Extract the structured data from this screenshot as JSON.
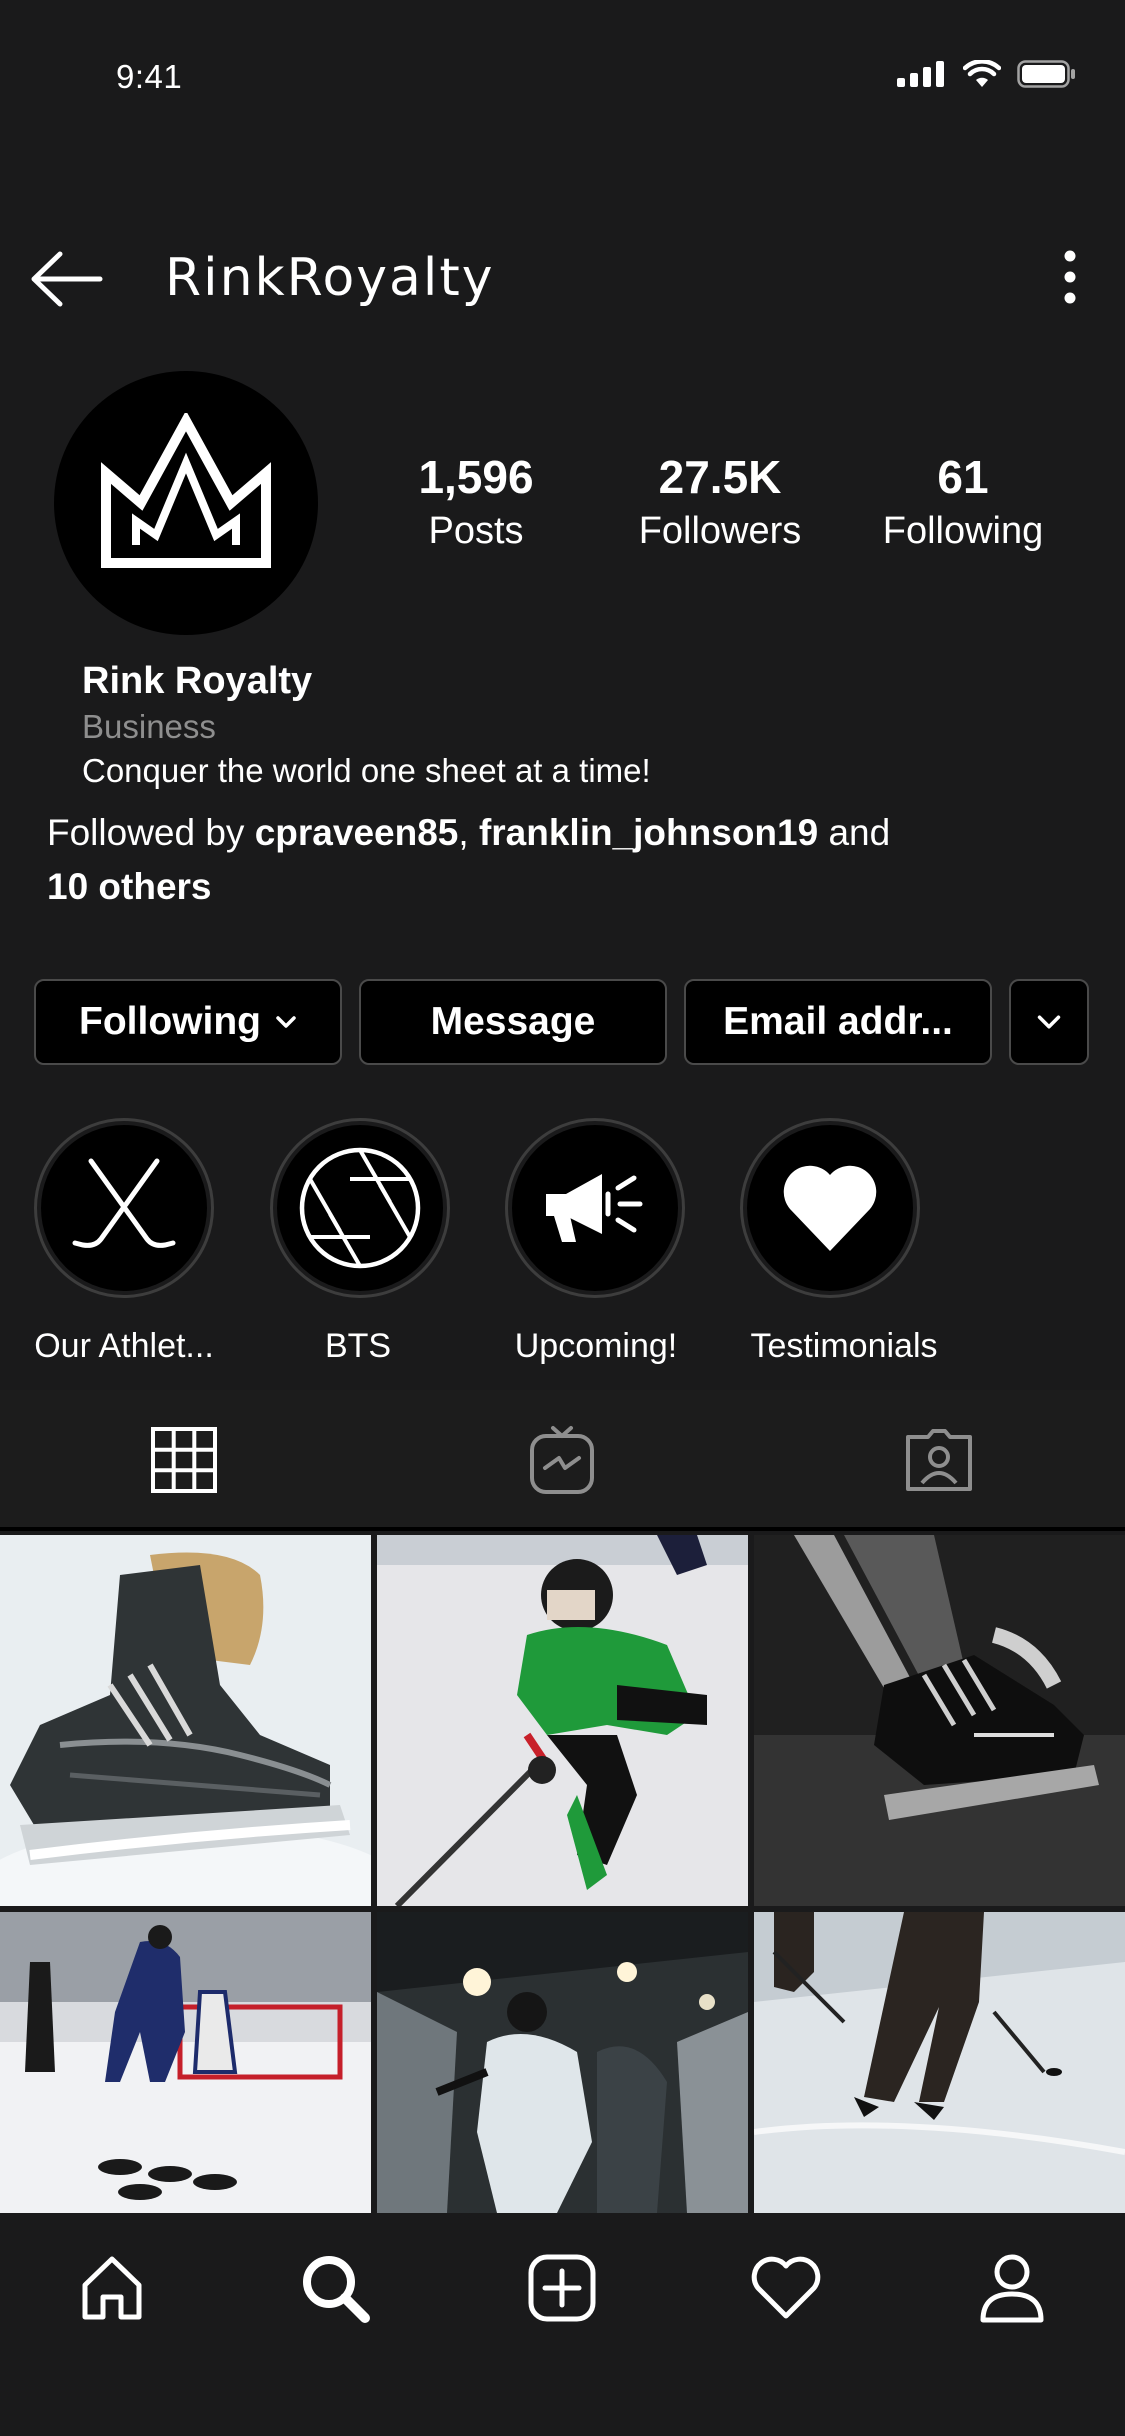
{
  "status": {
    "time": "9:41"
  },
  "header": {
    "title": "RinkRoyalty"
  },
  "profile": {
    "stats": [
      {
        "num": "1,596",
        "label": "Posts"
      },
      {
        "num": "27.5K",
        "label": "Followers"
      },
      {
        "num": "61",
        "label": "Following"
      }
    ],
    "name": "Rink Royalty",
    "category": "Business",
    "bio": "Conquer the world one sheet at a time!",
    "followed_by": {
      "prefix": "Followed by ",
      "user1": "cpraveen85",
      "sep": ", ",
      "user2": "franklin_johnson19",
      "mid": " and",
      "others": "10 others"
    }
  },
  "buttons": {
    "following": "Following",
    "message": "Message",
    "email": "Email addr..."
  },
  "highlights": [
    {
      "label": "Our Athlet...",
      "icon": "hockey-sticks-icon"
    },
    {
      "label": "BTS",
      "icon": "aperture-icon"
    },
    {
      "label": "Upcoming!",
      "icon": "megaphone-icon"
    },
    {
      "label": "Testimonials",
      "icon": "heart-icon"
    }
  ],
  "tabs": [
    "grid-icon",
    "igtv-icon",
    "tagged-icon"
  ],
  "nav": [
    "home-icon",
    "search-icon",
    "add-post-icon",
    "activity-heart-icon",
    "profile-icon"
  ],
  "colors": {
    "background": "#1a1a1b",
    "button_border": "#4a4a4a",
    "muted_text": "#8e8e8e"
  }
}
